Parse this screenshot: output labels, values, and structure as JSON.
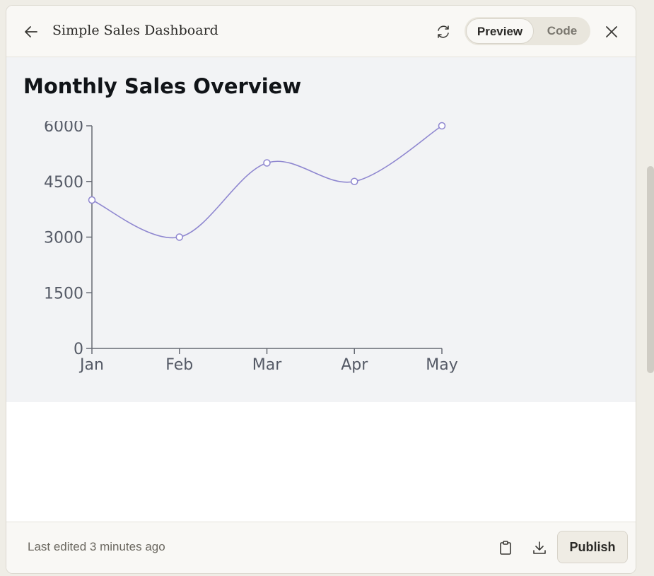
{
  "header": {
    "title": "Simple Sales Dashboard",
    "back_icon": "arrow-left-icon",
    "refresh_icon": "refresh-icon",
    "close_icon": "close-icon",
    "toggle": {
      "preview_label": "Preview",
      "code_label": "Code",
      "selected": "Preview"
    }
  },
  "content": {
    "heading": "Monthly Sales Overview"
  },
  "chart_data": {
    "type": "line",
    "title": "",
    "xlabel": "",
    "ylabel": "",
    "categories": [
      "Jan",
      "Feb",
      "Mar",
      "Apr",
      "May"
    ],
    "series": [
      {
        "values": [
          4000,
          3000,
          5000,
          4500,
          6000
        ]
      }
    ],
    "y_ticks": [
      0,
      1500,
      3000,
      4500,
      6000
    ],
    "ylim": [
      0,
      6000
    ],
    "grid": false,
    "colors": {
      "line": "#8f87d0",
      "axis": "#666a73",
      "marker_fill": "#ffffff"
    }
  },
  "footer": {
    "status": "Last edited 3 minutes ago",
    "copy_icon": "clipboard-icon",
    "download_icon": "download-icon",
    "publish_label": "Publish"
  }
}
